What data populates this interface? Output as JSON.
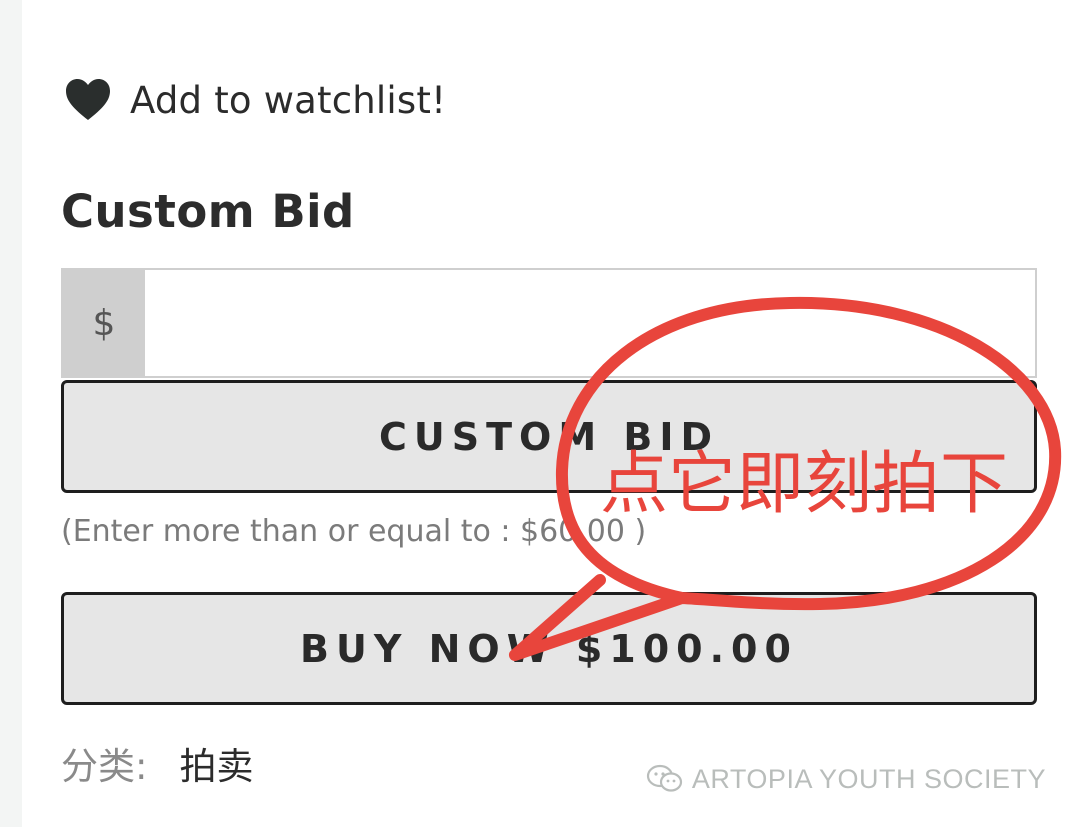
{
  "watchlist": {
    "icon": "heart-icon",
    "label": "Add to watchlist!"
  },
  "custom_bid": {
    "title": "Custom Bid",
    "currency_prefix": "$",
    "input_value": "",
    "button_label": "CUSTOM BID",
    "hint": "(Enter more than or equal to : $60.00 )"
  },
  "buy_now": {
    "button_label": "BUY NOW $100.00"
  },
  "category": {
    "label": "分类:",
    "value": "拍卖"
  },
  "annotation": {
    "text": "点它即刻拍下",
    "color": "#e8453c"
  },
  "watermark": {
    "icon": "wechat-icon",
    "text": "ARTOPIA YOUTH SOCIETY"
  }
}
